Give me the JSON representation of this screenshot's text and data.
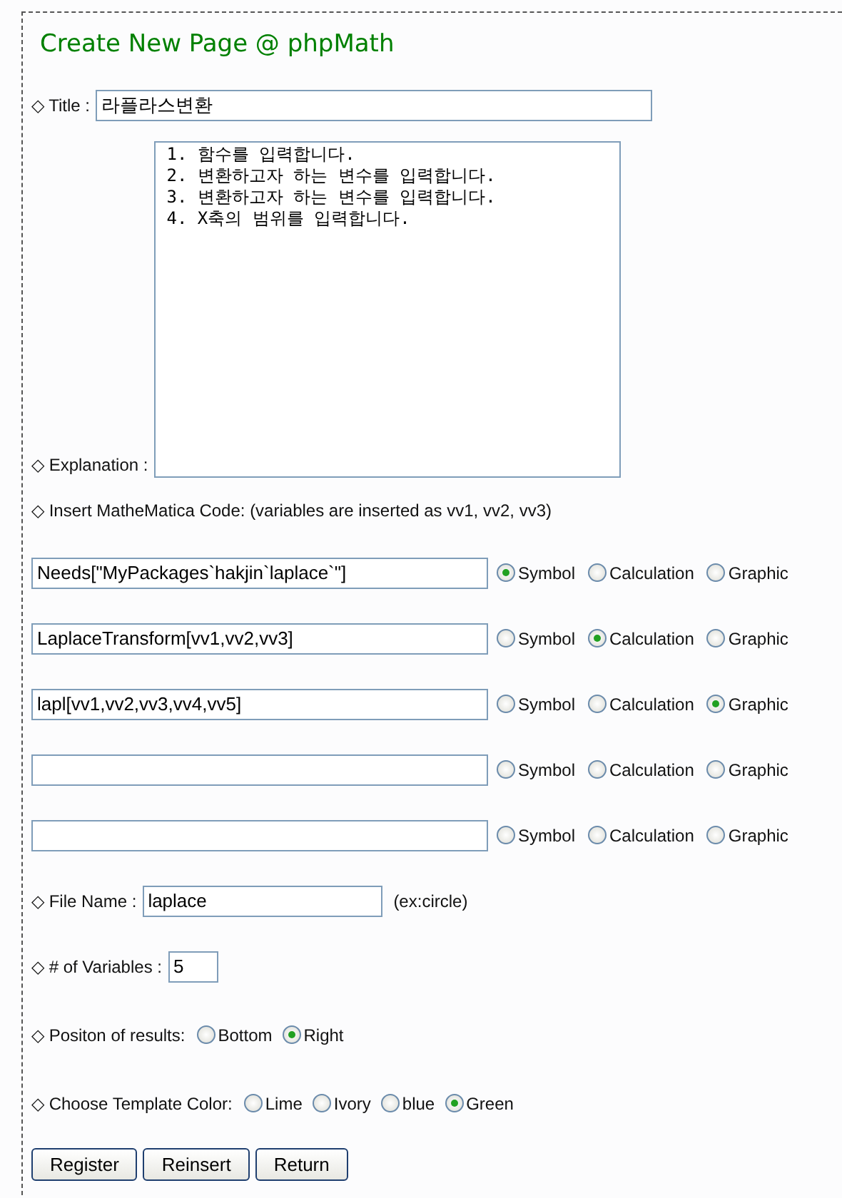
{
  "heading": "Create New Page @ phpMath",
  "title_field": {
    "label": "◇ Title :",
    "value": "라플라스변환"
  },
  "explanation": {
    "label": "◇ Explanation :",
    "lines": [
      "1. 함수를 입력합니다.",
      "2. 변환하고자 하는 변수를 입력합니다.",
      "3. 변환하고자 하는 변수를 입력합니다.",
      "4. X축의 범위를 입력합니다."
    ]
  },
  "code_section": {
    "label": "◇ Insert MatheMatica Code: (variables are inserted as vv1, vv2, vv3)"
  },
  "code_rows": [
    {
      "value": "Needs[\"MyPackages`hakjin`laplace`\"]",
      "options": [
        {
          "label": "Symbol",
          "selected": true
        },
        {
          "label": "Calculation",
          "selected": false
        },
        {
          "label": "Graphic",
          "selected": false
        }
      ]
    },
    {
      "value": "LaplaceTransform[vv1,vv2,vv3]",
      "options": [
        {
          "label": "Symbol",
          "selected": false
        },
        {
          "label": "Calculation",
          "selected": true
        },
        {
          "label": "Graphic",
          "selected": false
        }
      ]
    },
    {
      "value": "lapl[vv1,vv2,vv3,vv4,vv5]",
      "options": [
        {
          "label": "Symbol",
          "selected": false
        },
        {
          "label": "Calculation",
          "selected": false
        },
        {
          "label": "Graphic",
          "selected": true
        }
      ]
    },
    {
      "options": [
        {
          "label": "Symbol",
          "selected": false
        },
        {
          "label": "Calculation",
          "selected": false
        },
        {
          "label": "Graphic",
          "selected": false
        }
      ]
    },
    {
      "options": [
        {
          "label": "Symbol",
          "selected": false
        },
        {
          "label": "Calculation",
          "selected": false
        },
        {
          "label": "Graphic",
          "selected": false
        }
      ]
    }
  ],
  "file_name": {
    "label": "◇ File Name :",
    "value": "laplace",
    "hint": "(ex:circle)"
  },
  "variables": {
    "label": "◇ # of Variables :",
    "value": "5"
  },
  "position": {
    "label": "◇ Positon of results:",
    "options": [
      {
        "label": "Bottom",
        "selected": false
      },
      {
        "label": "Right",
        "selected": true
      }
    ]
  },
  "template_color": {
    "label": "◇ Choose Template Color:",
    "options": [
      {
        "label": "Lime",
        "selected": false
      },
      {
        "label": "Ivory",
        "selected": false
      },
      {
        "label": "blue",
        "selected": false
      },
      {
        "label": "Green",
        "selected": true
      }
    ]
  },
  "buttons": [
    "Register",
    "Reinsert",
    "Return"
  ]
}
